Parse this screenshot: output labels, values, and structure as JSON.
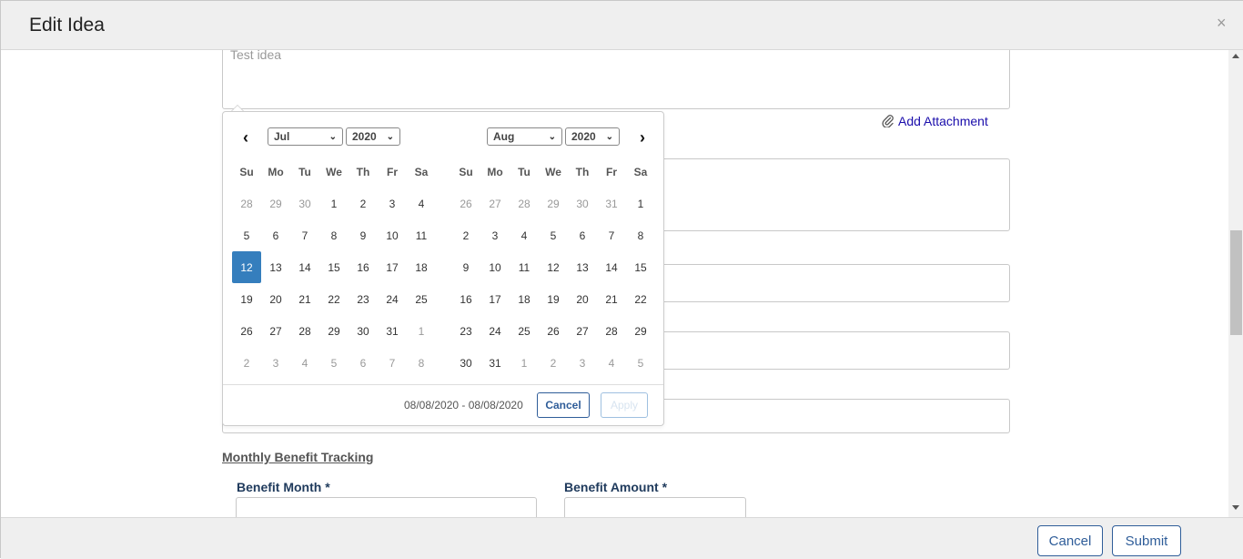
{
  "modal": {
    "title": "Edit Idea",
    "close_label": "×"
  },
  "form": {
    "description_value": "Test idea",
    "add_attachment_label": "Add Attachment",
    "section_title": "Monthly Benefit Tracking",
    "benefit_month_label": "Benefit Month *",
    "benefit_amount_label": "Benefit Amount *"
  },
  "datepicker": {
    "left": {
      "month": "Jul",
      "year": "2020",
      "weekdays": [
        "Su",
        "Mo",
        "Tu",
        "We",
        "Th",
        "Fr",
        "Sa"
      ],
      "days": [
        [
          "28",
          "29",
          "30",
          "1",
          "2",
          "3",
          "4"
        ],
        [
          "5",
          "6",
          "7",
          "8",
          "9",
          "10",
          "11"
        ],
        [
          "12",
          "13",
          "14",
          "15",
          "16",
          "17",
          "18"
        ],
        [
          "19",
          "20",
          "21",
          "22",
          "23",
          "24",
          "25"
        ],
        [
          "26",
          "27",
          "28",
          "29",
          "30",
          "31",
          "1"
        ],
        [
          "2",
          "3",
          "4",
          "5",
          "6",
          "7",
          "8"
        ]
      ]
    },
    "right": {
      "month": "Aug",
      "year": "2020",
      "weekdays": [
        "Su",
        "Mo",
        "Tu",
        "We",
        "Th",
        "Fr",
        "Sa"
      ],
      "days": [
        [
          "26",
          "27",
          "28",
          "29",
          "30",
          "31",
          "1"
        ],
        [
          "2",
          "3",
          "4",
          "5",
          "6",
          "7",
          "8"
        ],
        [
          "9",
          "10",
          "11",
          "12",
          "13",
          "14",
          "15"
        ],
        [
          "16",
          "17",
          "18",
          "19",
          "20",
          "21",
          "22"
        ],
        [
          "23",
          "24",
          "25",
          "26",
          "27",
          "28",
          "29"
        ],
        [
          "30",
          "31",
          "1",
          "2",
          "3",
          "4",
          "5"
        ]
      ]
    },
    "selected_date": "12",
    "range_text": "08/08/2020 - 08/08/2020",
    "cancel_label": "Cancel",
    "apply_label": "Apply",
    "accent_color": "#357ebd"
  },
  "footer": {
    "cancel_label": "Cancel",
    "submit_label": "Submit"
  }
}
